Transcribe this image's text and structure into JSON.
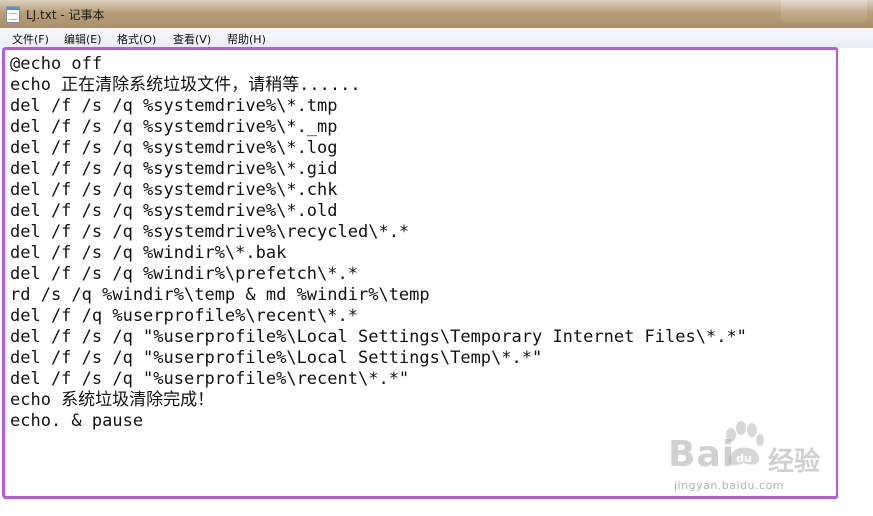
{
  "window": {
    "title": "LJ.txt - 记事本",
    "icon": "notepad-icon"
  },
  "menu": {
    "items": [
      "文件(F)",
      "编辑(E)",
      "格式(O)",
      "查看(V)",
      "帮助(H)"
    ]
  },
  "editor": {
    "highlight_color": "#b45ce0",
    "lines": [
      "@echo off",
      "echo 正在清除系统垃圾文件，请稍等......",
      "del /f /s /q %systemdrive%\\*.tmp",
      "del /f /s /q %systemdrive%\\*._mp",
      "del /f /s /q %systemdrive%\\*.log",
      "del /f /s /q %systemdrive%\\*.gid",
      "del /f /s /q %systemdrive%\\*.chk",
      "del /f /s /q %systemdrive%\\*.old",
      "del /f /s /q %systemdrive%\\recycled\\*.*",
      "del /f /s /q %windir%\\*.bak",
      "del /f /s /q %windir%\\prefetch\\*.*",
      "rd /s /q %windir%\\temp & md %windir%\\temp",
      "del /f /q %userprofile%\\recent\\*.*",
      "del /f /s /q \"%userprofile%\\Local Settings\\Temporary Internet Files\\*.*\"",
      "del /f /s /q \"%userprofile%\\Local Settings\\Temp\\*.*\"",
      "del /f /s /q \"%userprofile%\\recent\\*.*\"",
      "echo 系统垃圾清除完成！",
      "echo. & pause"
    ]
  },
  "watermark": {
    "brand_left": "Bai",
    "brand_right": "经验",
    "url": "jingyan.baidu.com",
    "icon": "baidu-paw-icon"
  }
}
